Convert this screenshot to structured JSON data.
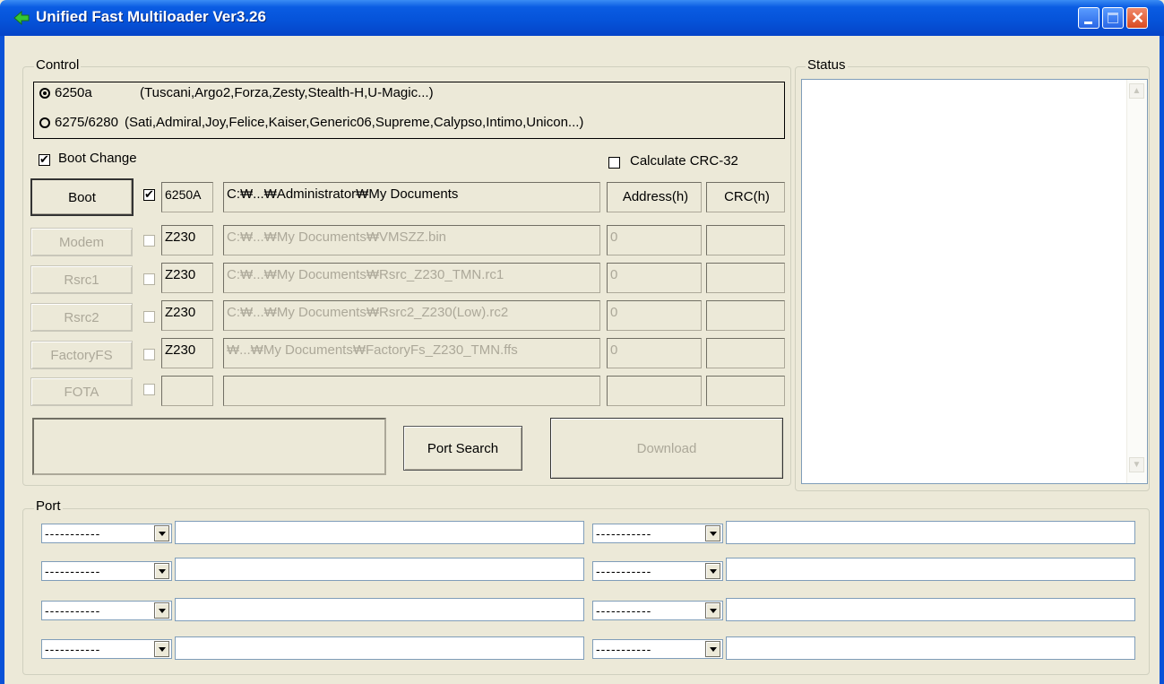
{
  "window": {
    "title": "Unified Fast Multiloader Ver3.26"
  },
  "control": {
    "group_label": "Control",
    "chip_options": [
      {
        "name": "6250a",
        "devices": "(Tuscani,Argo2,Forza,Zesty,Stealth-H,U-Magic...)",
        "selected": true
      },
      {
        "name": "6275/6280",
        "devices": "(Sati,Admiral,Joy,Felice,Kaiser,Generic06,Supreme,Calypso,Intimo,Unicon...)",
        "selected": false
      }
    ],
    "boot_change": {
      "label": "Boot Change",
      "checked": true
    },
    "calc_crc": {
      "label": "Calculate CRC-32",
      "checked": false
    },
    "address_header": "Address(h)",
    "crc_header": "CRC(h)",
    "rows": [
      {
        "button": "Boot",
        "checked": true,
        "model": "6250A",
        "path": "C:₩...₩Administrator₩My Documents",
        "address": "",
        "crc": "",
        "enabled": true
      },
      {
        "button": "Modem",
        "checked": false,
        "model": "Z230",
        "path": "C:₩...₩My Documents₩VMSZZ.bin",
        "address": "0",
        "crc": "",
        "enabled": false
      },
      {
        "button": "Rsrc1",
        "checked": false,
        "model": "Z230",
        "path": "C:₩...₩My Documents₩Rsrc_Z230_TMN.rc1",
        "address": "0",
        "crc": "",
        "enabled": false
      },
      {
        "button": "Rsrc2",
        "checked": false,
        "model": "Z230",
        "path": "C:₩...₩My Documents₩Rsrc2_Z230(Low).rc2",
        "address": "0",
        "crc": "",
        "enabled": false
      },
      {
        "button": "FactoryFS",
        "checked": false,
        "model": "Z230",
        "path": "₩...₩My Documents₩FactoryFs_Z230_TMN.ffs",
        "address": "0",
        "crc": "",
        "enabled": false
      },
      {
        "button": "FOTA",
        "checked": false,
        "model": "",
        "path": "",
        "address": "",
        "crc": "",
        "enabled": false
      }
    ],
    "port_search_label": "Port Search",
    "download_label": "Download"
  },
  "status": {
    "group_label": "Status",
    "scroll_up_icon": "scroll-up-arrow",
    "scroll_down_icon": "scroll-down-arrow"
  },
  "port": {
    "group_label": "Port",
    "slots": [
      {
        "value": "-----------"
      },
      {
        "value": "-----------"
      },
      {
        "value": "-----------"
      },
      {
        "value": "-----------"
      },
      {
        "value": "-----------"
      },
      {
        "value": "-----------"
      },
      {
        "value": "-----------"
      },
      {
        "value": "-----------"
      }
    ]
  },
  "colors": {
    "titlebar": "#0552d8",
    "face": "#ece9d8",
    "disabled_text": "#aca899"
  }
}
